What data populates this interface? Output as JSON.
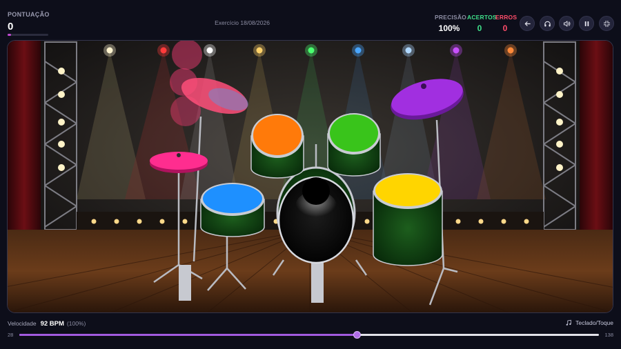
{
  "score": {
    "label": "PONTUAÇÃO",
    "value": "0",
    "progress": 0.08
  },
  "exercise": {
    "title": "Exercício 18/08/2026"
  },
  "stats": {
    "precision": {
      "label": "PRECISÃO",
      "value": "100%"
    },
    "hits": {
      "label": "ACERTOS",
      "value": "0"
    },
    "errors": {
      "label": "ERROS",
      "value": "0"
    }
  },
  "controls": [
    {
      "icon": "arrow-left-icon"
    },
    {
      "icon": "headphones-icon"
    },
    {
      "icon": "speaker-icon"
    },
    {
      "icon": "pause-icon"
    },
    {
      "icon": "exit-fullscreen-icon"
    }
  ],
  "drum_kit": {
    "pads": [
      {
        "name": "tom-1",
        "color": "#ff7a0a"
      },
      {
        "name": "tom-2",
        "color": "#39c41b"
      },
      {
        "name": "snare",
        "color": "#1e90ff"
      },
      {
        "name": "floor-tom",
        "color": "#ffd500"
      },
      {
        "name": "hi-hat",
        "color": "#ff2d8f"
      },
      {
        "name": "crash-cymbal",
        "color": "#ff4f7a"
      },
      {
        "name": "ride-cymbal",
        "color": "#a12fe0"
      },
      {
        "name": "bass-drum",
        "color": "#0a0a0a"
      }
    ],
    "stage_light_colors": [
      "#fff4d0",
      "#ff3b3b",
      "#ffffff",
      "#ffd26a",
      "#4aff70",
      "#4aa6ff",
      "#b0d8ff",
      "#c850ff",
      "#ff8a3a"
    ]
  },
  "speed": {
    "label": "Velocidade",
    "value": "92 BPM",
    "percent": "(100%)",
    "min": "28",
    "max": "138",
    "bpm": 92
  },
  "input_mode": {
    "label": "Teclado/Toque",
    "icon": "music-note-icon"
  }
}
